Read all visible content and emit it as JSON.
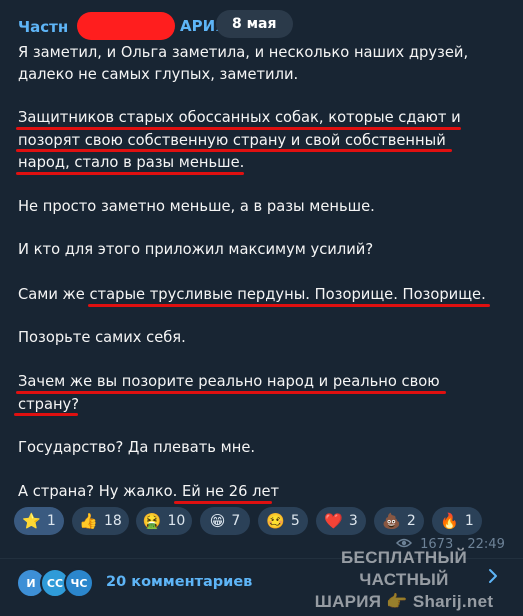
{
  "channel": {
    "name_prefix": "Частн",
    "name_suffix": "АРИЯ"
  },
  "date_label": "8 мая",
  "message_lines": [
    "Я заметил, и Ольга заметила, и несколько наших друзей,",
    "далеко не самых глупых, заметили.",
    "Защитников старых обоссанных собак, которые сдают и",
    "позорят свою собственную страну и свой собственный",
    "народ, стало в разы меньше.",
    "Не просто заметно меньше, а в разы меньше.",
    "И кто для этого приложил максимум усилий?",
    "Сами же старые трусливые пердуны. Позорище. Позорище.",
    "Позорьте самих себя.",
    "Зачем же вы позорите реально народ и реально свою",
    "страну?",
    "Государство? Да плевать мне.",
    "А страна? Ну жалко. Ей не 26 лет"
  ],
  "reactions": [
    {
      "emoji": "⭐",
      "count": "1"
    },
    {
      "emoji": "👍",
      "count": "18"
    },
    {
      "emoji": "🤮",
      "count": "10"
    },
    {
      "emoji": "😁",
      "count": "7"
    },
    {
      "emoji": "🥴",
      "count": "5"
    },
    {
      "emoji": "❤️",
      "count": "3"
    },
    {
      "emoji": "💩",
      "count": "2"
    },
    {
      "emoji": "🔥",
      "count": "1"
    }
  ],
  "views": "1673",
  "time": "22:49",
  "comment_avatars": [
    {
      "initials": "И",
      "color": "#3d8fd6"
    },
    {
      "initials": "СС",
      "color": "#2f9bd8"
    },
    {
      "initials": "ЧС",
      "color": "#2b86cc"
    }
  ],
  "comments_label": "20 комментариев",
  "watermark": {
    "line1": "БЕСПЛАТНЫЙ ЧАСТНЫЙ",
    "line2": "ШАРИЯ 👉 Sharij.net"
  },
  "colors": {
    "background": "#0e1621",
    "bubble": "#182533",
    "accent": "#5eb5f7",
    "underline": "#e01010",
    "redaction": "#ff1e1e"
  },
  "icons": {
    "views": "eye-icon",
    "open": "chevron-right-icon"
  }
}
